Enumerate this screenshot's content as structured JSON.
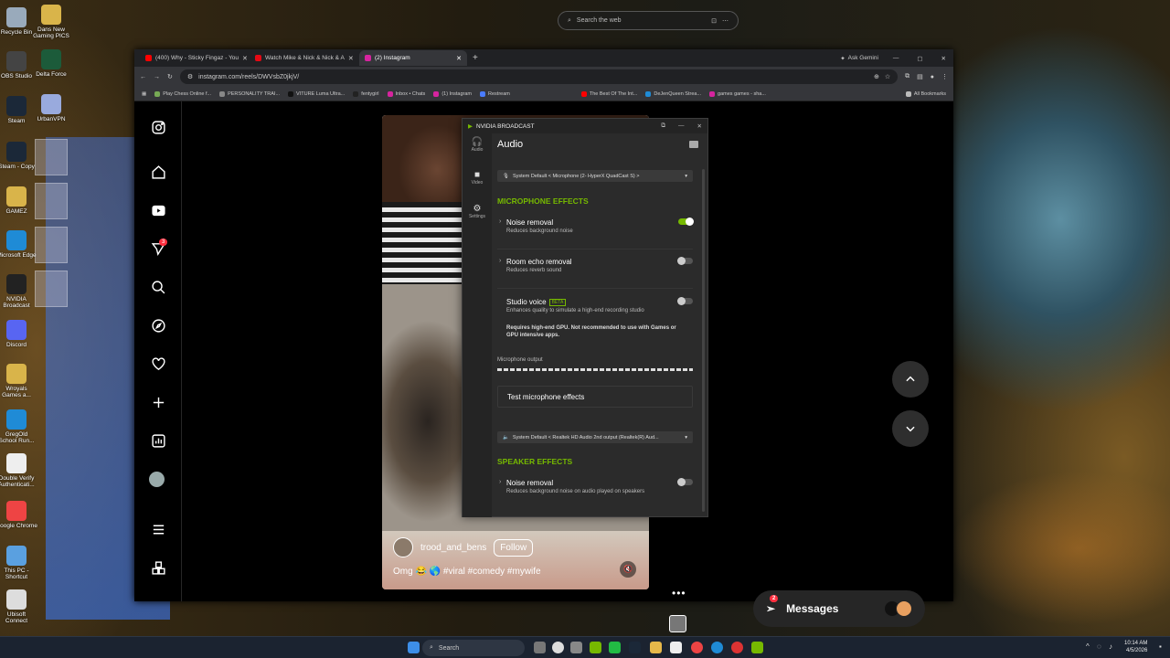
{
  "desktop": {
    "icons": [
      {
        "label": "Recycle Bin",
        "color": "#9ab"
      },
      {
        "label": "OBS Studio",
        "color": "#444"
      },
      {
        "label": "Steam",
        "color": "#1b2838"
      },
      {
        "label": "Steam - Copy",
        "color": "#1b2838"
      },
      {
        "label": "GAMEZ",
        "color": "#d9b44a"
      },
      {
        "label": "Microsoft Edge",
        "color": "#1f8bd6"
      },
      {
        "label": "NVIDIA Broadcast",
        "color": "#222"
      },
      {
        "label": "Discord",
        "color": "#5865f2"
      },
      {
        "label": "Wroyals Games a...",
        "color": "#d9b44a"
      },
      {
        "label": "GregOld School Run...",
        "color": "#1f8bd6"
      },
      {
        "label": "Double Verify Authenticati...",
        "color": "#eee"
      },
      {
        "label": "Google Chrome",
        "color": "#e44"
      },
      {
        "label": "This PC - Shortcut",
        "color": "#5aa0e0"
      },
      {
        "label": "Ubisoft Connect",
        "color": "#ddd"
      }
    ],
    "icons2": [
      {
        "label": "Dans New Gaming PICS",
        "color": "#d9b44a"
      },
      {
        "label": "Delta Force",
        "color": "#1c5b3a"
      },
      {
        "label": "UrbanVPN",
        "color": "#9ad"
      }
    ]
  },
  "top_search": {
    "placeholder": "Search the web"
  },
  "browser": {
    "tabs": [
      {
        "label": "(400) Why - Sticky Fingaz - You",
        "color": "#f00"
      },
      {
        "label": "Watch Mike & Nick & Nick & A",
        "color": "#e50914"
      },
      {
        "label": "(2) Instagram",
        "color": "#d6249f"
      }
    ],
    "new_tab": "+",
    "ask_gemini": "Ask Gemini",
    "url": "instagram.com/reels/DWVsbZ0jkjV/",
    "bookmarks": [
      {
        "label": "Play Chess Online f...",
        "color": "#7a5"
      },
      {
        "label": "PERSONALITY TRAI...",
        "color": "#888"
      },
      {
        "label": "VITURE Luma Ultra...",
        "color": "#111"
      },
      {
        "label": "fentygirl",
        "color": "#222"
      },
      {
        "label": "Inbox • Chats",
        "color": "#d6249f"
      },
      {
        "label": "(1) Instagram",
        "color": "#d6249f"
      },
      {
        "label": "Restream",
        "color": "#4a7cff"
      },
      {
        "label": "The Best Of The Int...",
        "color": "#f00"
      },
      {
        "label": "DeJenQueen Strea...",
        "color": "#1f8bd6"
      },
      {
        "label": "games games - sha...",
        "color": "#d6249f"
      }
    ],
    "all_bookmarks": "All Bookmarks"
  },
  "instagram": {
    "notification_count": "3",
    "reel": {
      "username": "trood_and_bens",
      "follow": "Follow",
      "caption": "Omg 😂 🌎 #viral #comedy #mywife"
    },
    "more": "•••",
    "messages": {
      "label": "Messages",
      "count": "2"
    }
  },
  "nvidia": {
    "title": "NVIDIA BROADCAST",
    "nav": [
      {
        "label": "Audio"
      },
      {
        "label": "Video"
      },
      {
        "label": "Settings"
      }
    ],
    "heading": "Audio",
    "mic_device": "System Default < Microphone (2- HyperX QuadCast S) >",
    "mic_section": "MICROPHONE EFFECTS",
    "effects": [
      {
        "title": "Noise removal",
        "desc": "Reduces background noise",
        "on": true
      },
      {
        "title": "Room echo removal",
        "desc": "Reduces reverb sound",
        "on": false
      },
      {
        "title": "Studio voice",
        "desc": "Enhances quality to simulate a high-end recording studio",
        "on": false,
        "badge": "BETA"
      }
    ],
    "warning": "Requires high-end GPU. Not recommended to use with Games or GPU intensive apps.",
    "mic_output": "Microphone output",
    "test": "Test microphone effects",
    "speaker_device": "System Default < Realtek HD Audio 2nd output (Realtek(R) Aud...",
    "speaker_section": "SPEAKER EFFECTS",
    "speaker_effect": {
      "title": "Noise removal",
      "desc": "Reduces background noise on audio played on speakers",
      "on": false
    }
  },
  "taskbar": {
    "search": "Search",
    "time": "10:14 AM",
    "date": "4/5/2026"
  }
}
